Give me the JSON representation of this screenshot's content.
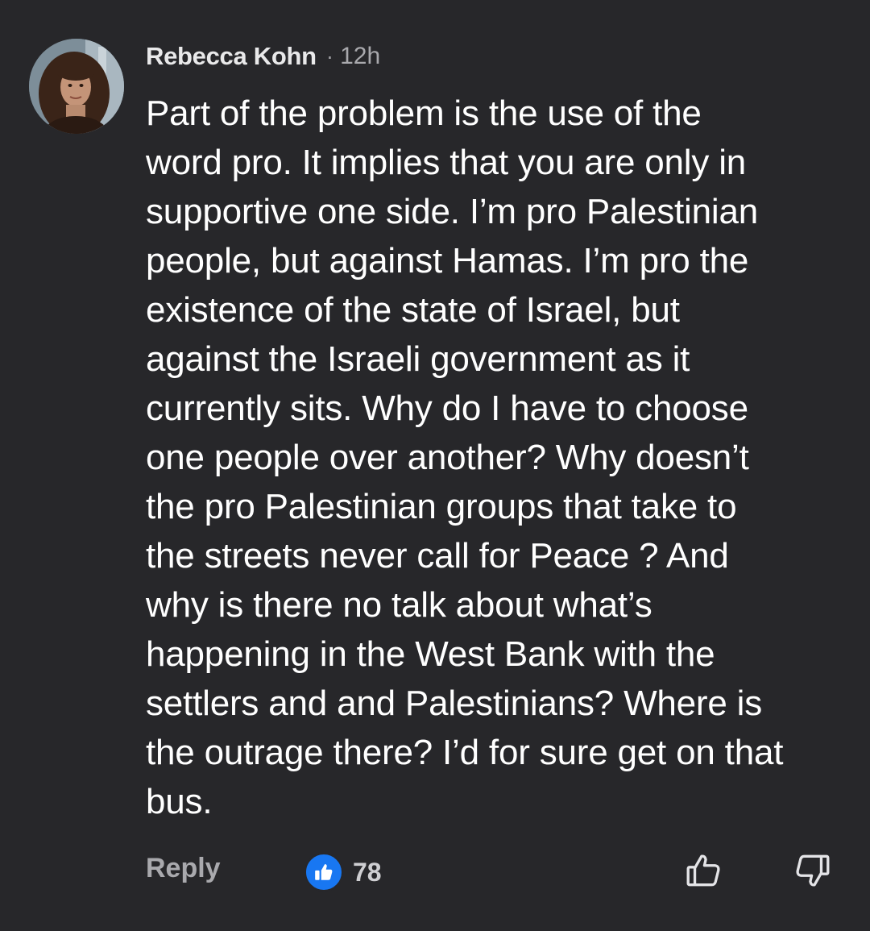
{
  "comment": {
    "author": "Rebecca Kohn",
    "separator": "·",
    "time": "12h",
    "body_lines": [
      "Part of the problem is the use of the",
      "word pro. It implies that you are only in",
      "supportive one side. I’m pro Palestinian",
      "people, but against Hamas. I’m pro the",
      "existence of the state of Israel, but",
      "against the Israeli government as it",
      "currently sits. Why do I have to choose",
      "one people over another? Why doesn’t",
      "the pro Palestinian groups that take to",
      "the streets never call for Peace ? And",
      "why is there no talk about what’s",
      "happening in the West Bank with the",
      "settlers and and Palestinians? Where is",
      "the outrage there? I’d for sure get on that",
      "bus."
    ],
    "actions": {
      "reply_label": "Reply",
      "like_count": "78"
    },
    "icons": {
      "avatar": "user-avatar",
      "like_badge": "thumbs-up-icon",
      "upvote": "thumbs-up-outline-icon",
      "downvote": "thumbs-down-outline-icon"
    }
  },
  "colors": {
    "background": "#27272a",
    "text": "#ffffff",
    "muted": "#a9a9ad",
    "like_blue": "#1877f2"
  }
}
